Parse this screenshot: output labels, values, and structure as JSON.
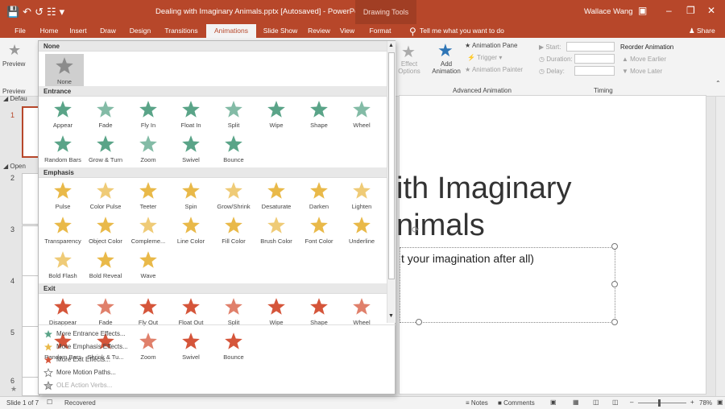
{
  "app": {
    "title": "Dealing with Imaginary Animals.pptx [Autosaved] - PowerPoint",
    "context_tab": "Drawing Tools",
    "user": "Wallace Wang",
    "search": "Tell me what you want to do",
    "share": "Share"
  },
  "tabs": [
    "File",
    "Home",
    "Insert",
    "Draw",
    "Design",
    "Transitions",
    "Animations",
    "Slide Show",
    "Review",
    "View",
    "Format"
  ],
  "ribbon": {
    "preview": "Preview",
    "preview_group": "Preview",
    "effect_options": "Effect Options",
    "add_animation": "Add Animation",
    "animation_pane": "Animation Pane",
    "trigger": "Trigger",
    "animation_painter": "Animation Painter",
    "adv_group": "Advanced Animation",
    "start": "Start:",
    "duration": "Duration:",
    "delay": "Delay:",
    "timing_group": "Timing",
    "reorder": "Reorder Animation",
    "move_earlier": "Move Earlier",
    "move_later": "Move Later"
  },
  "gallery": {
    "none_header": "None",
    "none_item": "None",
    "sections": [
      {
        "title": "Entrance",
        "color": "#5aa488",
        "items": [
          "Appear",
          "Fade",
          "Fly In",
          "Float In",
          "Split",
          "Wipe",
          "Shape",
          "Wheel",
          "Random Bars",
          "Grow & Turn",
          "Zoom",
          "Swivel",
          "Bounce"
        ]
      },
      {
        "title": "Emphasis",
        "color": "#e9b949",
        "items": [
          "Pulse",
          "Color Pulse",
          "Teeter",
          "Spin",
          "Grow/Shrink",
          "Desaturate",
          "Darken",
          "Lighten",
          "Transparency",
          "Object Color",
          "Compleme...",
          "Line Color",
          "Fill Color",
          "Brush Color",
          "Font Color",
          "Underline",
          "Bold Flash",
          "Bold Reveal",
          "Wave"
        ]
      },
      {
        "title": "Exit",
        "color": "#d5553a",
        "items": [
          "Disappear",
          "Fade",
          "Fly Out",
          "Float Out",
          "Split",
          "Wipe",
          "Shape",
          "Wheel",
          "Random Bars",
          "Shrink & Tu...",
          "Zoom",
          "Swivel",
          "Bounce"
        ]
      }
    ],
    "more": [
      "More Entrance Effects...",
      "More Emphasis Effects...",
      "More Exit Effects...",
      "More Motion Paths...",
      "OLE Action Verbs..."
    ]
  },
  "slides": {
    "numbers": [
      "1",
      "2",
      "3",
      "4",
      "5",
      "6"
    ],
    "group1": "Defau",
    "group2": "Open"
  },
  "slide": {
    "title_line1": "ith Imaginary",
    "title_line2": "nimals",
    "subtitle": "t your imagination after all)"
  },
  "status": {
    "slide": "Slide 1 of 7",
    "recovered": "Recovered",
    "notes": "Notes",
    "comments": "Comments",
    "zoom": "78%"
  },
  "colors": {
    "accent": "#b7472a",
    "entrance": "#5aa488",
    "emphasis": "#e9b949",
    "exit": "#d5553a"
  }
}
